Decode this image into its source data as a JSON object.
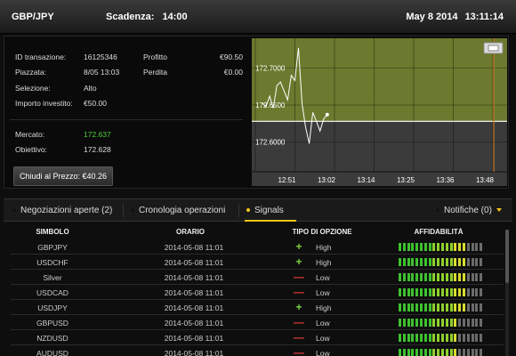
{
  "header": {
    "pair": "GBP/JPY",
    "expiry_label": "Scadenza:",
    "expiry_value": "14:00",
    "date": "May 8 2014",
    "time": "13:11:14"
  },
  "trade": {
    "id_label": "ID transazione:",
    "id_value": "16125346",
    "placed_label": "Piazzata:",
    "placed_value": "8/05 13:03",
    "selection_label": "Selezione:",
    "selection_value": "Alto",
    "amount_label": "Importo investito:",
    "amount_value": "€50.00",
    "profit_label": "Profitto",
    "profit_value": "€90.50",
    "loss_label": "Perdita",
    "loss_value": "€0.00",
    "market_label": "Mercato:",
    "market_value": "172.637",
    "target_label": "Obiettivo:",
    "target_value": "172.628",
    "close_button": "Chiudi al Prezzo: €40.26"
  },
  "chart": {
    "ytick_labels": [
      "172.7000",
      "172.6500",
      "172.6000"
    ],
    "xtick_labels": [
      "12:51",
      "13:02",
      "13:14",
      "13:25",
      "13:36",
      "13:48"
    ],
    "target_line": 172.628,
    "upper_zone_color": "#6b7a2e",
    "lower_zone_color": "#3b3b3b",
    "expiry_line_color": "#c8782a"
  },
  "chart_data": {
    "type": "line",
    "ytick_values": [
      172.7,
      172.65,
      172.6
    ],
    "x": [
      "12:51",
      "12:52",
      "12:53",
      "12:54",
      "12:55",
      "12:56",
      "12:57",
      "12:58",
      "12:59",
      "13:00",
      "13:01",
      "13:02",
      "13:03",
      "13:04",
      "13:05",
      "13:06",
      "13:07",
      "13:08",
      "13:09"
    ],
    "values": [
      172.652,
      172.648,
      172.662,
      172.646,
      172.676,
      172.681,
      172.669,
      172.657,
      172.69,
      172.683,
      172.727,
      172.652,
      172.62,
      172.598,
      172.64,
      172.628,
      172.615,
      172.631,
      172.637
    ],
    "ylim": [
      172.56,
      172.74
    ]
  },
  "tabs": {
    "open_trades": "Negoziazioni aperte (2)",
    "history": "Cronologia operazioni",
    "signals": "Signals",
    "notifications": "Notifiche (0)"
  },
  "table": {
    "headers": {
      "symbol": "SIMBOLO",
      "time": "ORARIO",
      "option_type": "TIPO DI OPZIONE",
      "reliability": "AFFIDABILITÀ"
    },
    "rows": [
      {
        "symbol": "GBPJPY",
        "time": "2014-05-08 11:01",
        "sign": "+",
        "type": "High",
        "reliability": 0.8
      },
      {
        "symbol": "USDCHF",
        "time": "2014-05-08 11:01",
        "sign": "+",
        "type": "High",
        "reliability": 0.8
      },
      {
        "symbol": "Silver",
        "time": "2014-05-08 11:01",
        "sign": "—",
        "type": "Low",
        "reliability": 0.8
      },
      {
        "symbol": "USDCAD",
        "time": "2014-05-08 11:01",
        "sign": "—",
        "type": "Low",
        "reliability": 0.8
      },
      {
        "symbol": "USDJPY",
        "time": "2014-05-08 11:01",
        "sign": "+",
        "type": "High",
        "reliability": 0.8
      },
      {
        "symbol": "GBPUSD",
        "time": "2014-05-08 11:01",
        "sign": "—",
        "type": "Low",
        "reliability": 0.72
      },
      {
        "symbol": "NZDUSD",
        "time": "2014-05-08 11:01",
        "sign": "—",
        "type": "Low",
        "reliability": 0.72
      },
      {
        "symbol": "AUDUSD",
        "time": "2014-05-08 11:01",
        "sign": "—",
        "type": "Low",
        "reliability": 0.72
      }
    ]
  },
  "colors": {
    "accent": "#f5c518",
    "plus": "#7cd13b",
    "minus": "#e03b3b",
    "market": "#4cd137"
  }
}
